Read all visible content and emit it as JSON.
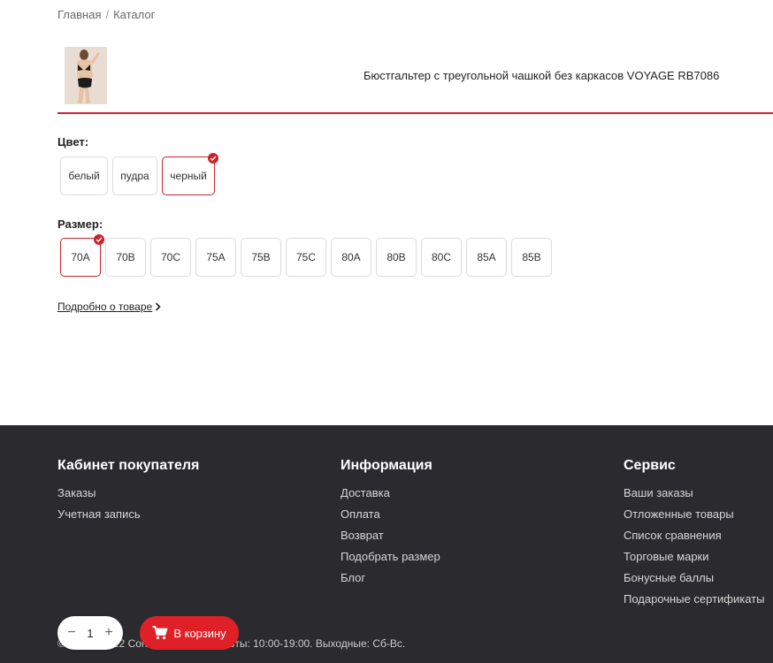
{
  "breadcrumb": {
    "home": "Главная",
    "separator": "/",
    "catalog": "Каталог"
  },
  "product": {
    "title": "Бюстгальтер с треугольной чашкой без каркасов VOYAGE RB7086"
  },
  "color": {
    "label": "Цвет:",
    "options": [
      "белый",
      "пудра",
      "черный"
    ],
    "selected": "черный"
  },
  "size": {
    "label": "Размер:",
    "options": [
      "70A",
      "70B",
      "70C",
      "75A",
      "75B",
      "75C",
      "80A",
      "80B",
      "80C",
      "85A",
      "85B"
    ],
    "selected": "70A"
  },
  "details_link": "Подробно о товаре",
  "footer": {
    "col1": {
      "title": "Кабинет покупателя",
      "links": [
        "Заказы",
        "Учетная запись"
      ]
    },
    "col2": {
      "title": "Информация",
      "links": [
        "Доставка",
        "Оплата",
        "Возврат",
        "Подобрать размер",
        "Блог"
      ]
    },
    "col3": {
      "title": "Сервис",
      "links": [
        "Ваши заказы",
        "Отложенные товары",
        "Список сравнения",
        "Торговые марки",
        "Бонусные баллы",
        "Подарочные сертификаты"
      ]
    },
    "copyright": "© 2009 - 2022 Conte.by. Режим работы: 10:00-19:00. Выходные: Сб-Вс."
  },
  "cart": {
    "qty_minus": "−",
    "qty_value": "1",
    "qty_plus": "+",
    "button_label": "В корзину"
  },
  "colors": {
    "accent": "#c9252c",
    "cart_red": "#e02027",
    "footer_bg": "#2b2b2f"
  },
  "icons": {
    "check": "check-icon",
    "cart": "cart-icon",
    "chevron": "chevron-right-icon"
  }
}
